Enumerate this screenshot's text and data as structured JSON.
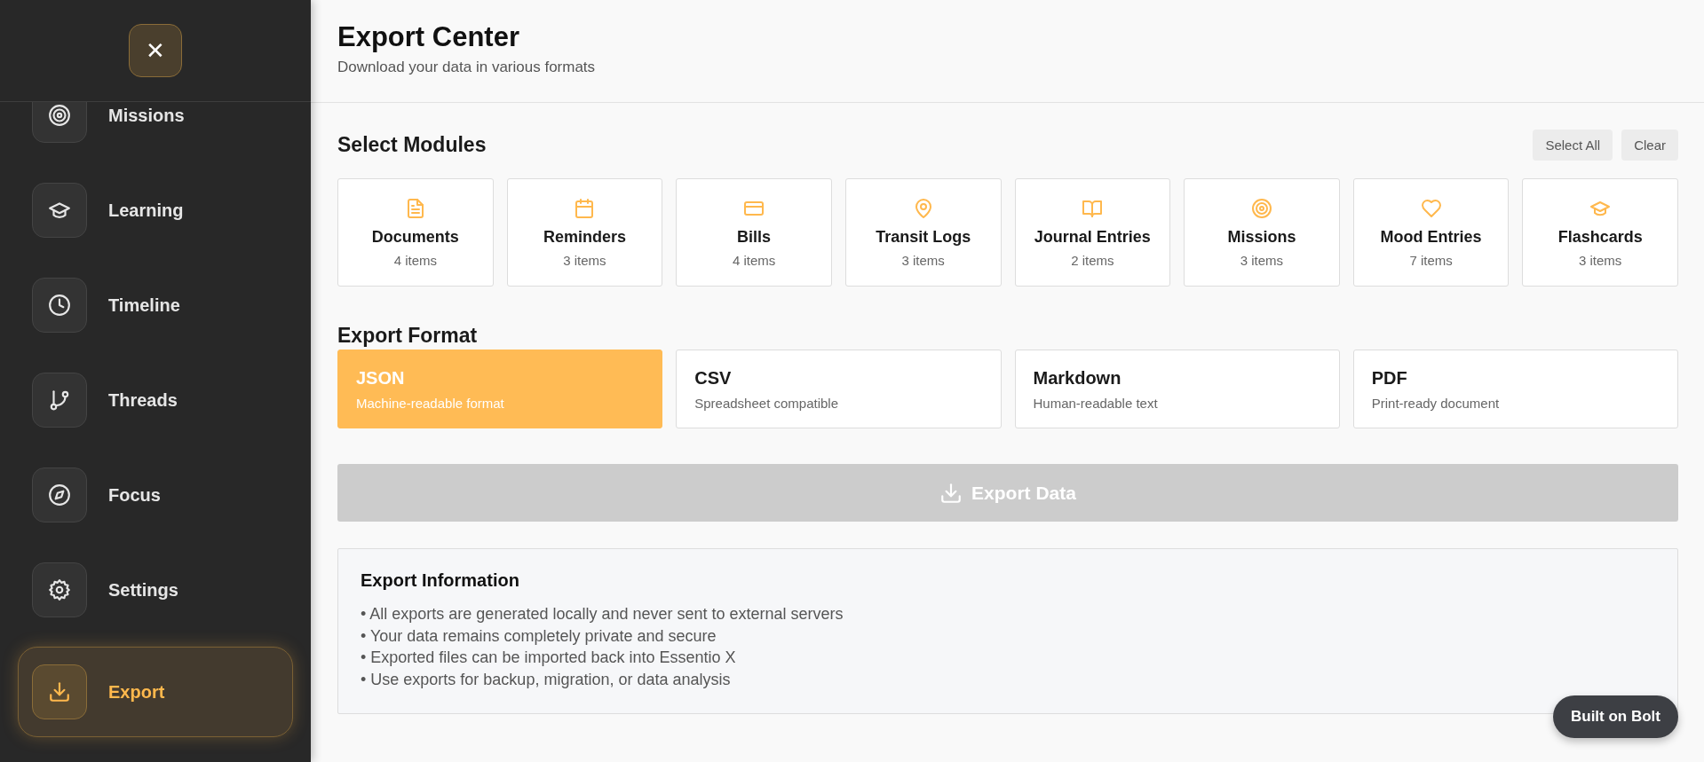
{
  "sidebar": {
    "close_label": "✕",
    "items": [
      {
        "label": "Missions",
        "kind": "target",
        "selected": false
      },
      {
        "label": "Learning",
        "kind": "cap",
        "selected": false
      },
      {
        "label": "Timeline",
        "kind": "clock",
        "selected": false
      },
      {
        "label": "Threads",
        "kind": "branch",
        "selected": false
      },
      {
        "label": "Focus",
        "kind": "compass",
        "selected": false
      },
      {
        "label": "Settings",
        "kind": "gear",
        "selected": false
      },
      {
        "label": "Export",
        "kind": "download",
        "selected": true
      }
    ]
  },
  "header": {
    "title": "Export Center",
    "subtitle": "Download your data in various formats"
  },
  "modules": {
    "title": "Select Modules",
    "actions": [
      "Select All",
      "Clear"
    ],
    "items": [
      {
        "name": "Documents",
        "count": "4 items",
        "kind": "document",
        "selected": false
      },
      {
        "name": "Reminders",
        "count": "3 items",
        "kind": "calendar",
        "selected": false
      },
      {
        "name": "Bills",
        "count": "4 items",
        "kind": "card",
        "selected": false
      },
      {
        "name": "Transit Logs",
        "count": "3 items",
        "kind": "pin",
        "selected": false
      },
      {
        "name": "Journal Entries",
        "count": "2 items",
        "kind": "book",
        "selected": false
      },
      {
        "name": "Missions",
        "count": "3 items",
        "kind": "target",
        "selected": false
      },
      {
        "name": "Mood Entries",
        "count": "7 items",
        "kind": "heart",
        "selected": false
      },
      {
        "name": "Flashcards",
        "count": "3 items",
        "kind": "cap",
        "selected": false
      }
    ]
  },
  "format": {
    "title": "Export Format",
    "options": [
      {
        "name": "JSON",
        "description": "Machine-readable format",
        "selected": true
      },
      {
        "name": "CSV",
        "description": "Spreadsheet compatible",
        "selected": false
      },
      {
        "name": "Markdown",
        "description": "Human-readable text",
        "selected": false
      },
      {
        "name": "PDF",
        "description": "Print-ready document",
        "selected": false
      }
    ]
  },
  "export_button": {
    "label": "Export Data",
    "disabled": true
  },
  "info": {
    "title": "Export Information",
    "lines": [
      "• All exports are generated locally and never sent to external servers",
      "• Your data remains completely private and secure",
      "• Exported files can be imported back into Essentio X",
      "• Use exports for backup, migration, or data analysis"
    ]
  },
  "badge": "Built on Bolt"
}
